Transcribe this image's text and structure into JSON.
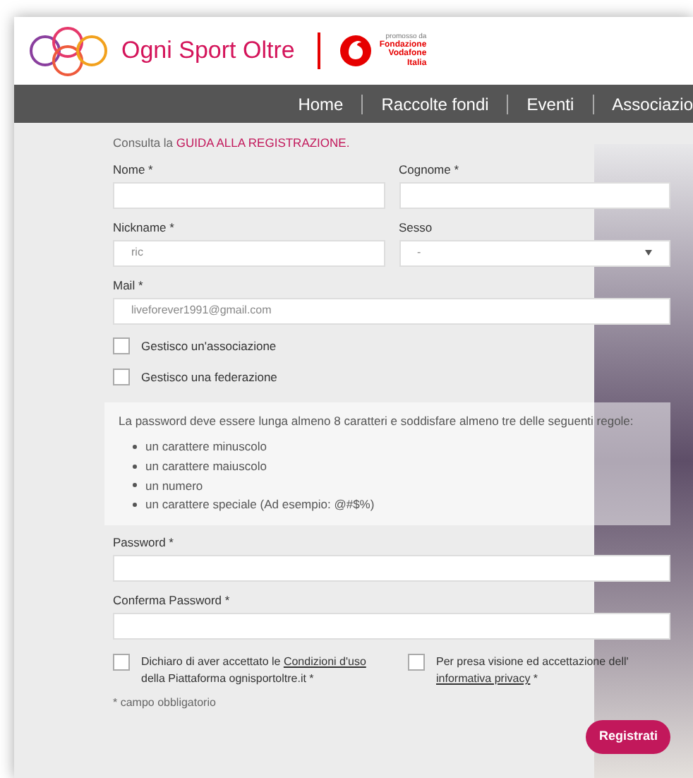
{
  "header": {
    "brand": "Ogni Sport Oltre",
    "sponsor": {
      "caption": "promosso da",
      "lines": [
        "Fondazione",
        "Vodafone",
        "Italia"
      ]
    }
  },
  "nav": [
    "Home",
    "Raccolte fondi",
    "Eventi",
    "Associazio"
  ],
  "intro": {
    "text": "Consulta la ",
    "link": "GUIDA ALLA REGISTRAZIONE."
  },
  "rows": [
    {
      "fields": [
        {
          "kind": "text",
          "label": "Nome *"
        },
        {
          "kind": "text",
          "label": "Cognome *"
        }
      ]
    },
    {
      "fields": [
        {
          "kind": "text",
          "label": "Nickname *",
          "value": "ric"
        },
        {
          "kind": "select",
          "label": "Sesso",
          "value": "-"
        }
      ]
    },
    {
      "fields": [
        {
          "kind": "text",
          "label": "Mail *",
          "value": "liveforever1991@gmail.com"
        }
      ]
    }
  ],
  "options": [
    {
      "label": "Gestisco un'associazione",
      "checked": false
    },
    {
      "label": "Gestisco una federazione",
      "checked": false
    }
  ],
  "password_rules": {
    "intro": "La password deve essere lunga almeno 8 caratteri e soddisfare almeno tre delle seguenti regole:",
    "items": [
      "un carattere minuscolo",
      "un carattere maiuscolo",
      "un numero",
      "un carattere speciale (Ad esempio: @#$%)"
    ]
  },
  "password_fields": [
    {
      "label": "Password *"
    },
    {
      "label": "Conferma Password *"
    }
  ],
  "consents": [
    {
      "before": "Dichiaro di aver accettato le ",
      "link": "Condizioni d'uso",
      "after": " della Piattaforma ognisportoltre.it *",
      "checked": false
    },
    {
      "before": "Per presa visione ed accettazione dell' ",
      "link": "informativa privacy",
      "after": " *",
      "checked": false
    }
  ],
  "note": "* campo obbligatorio",
  "submit": "Registrati"
}
